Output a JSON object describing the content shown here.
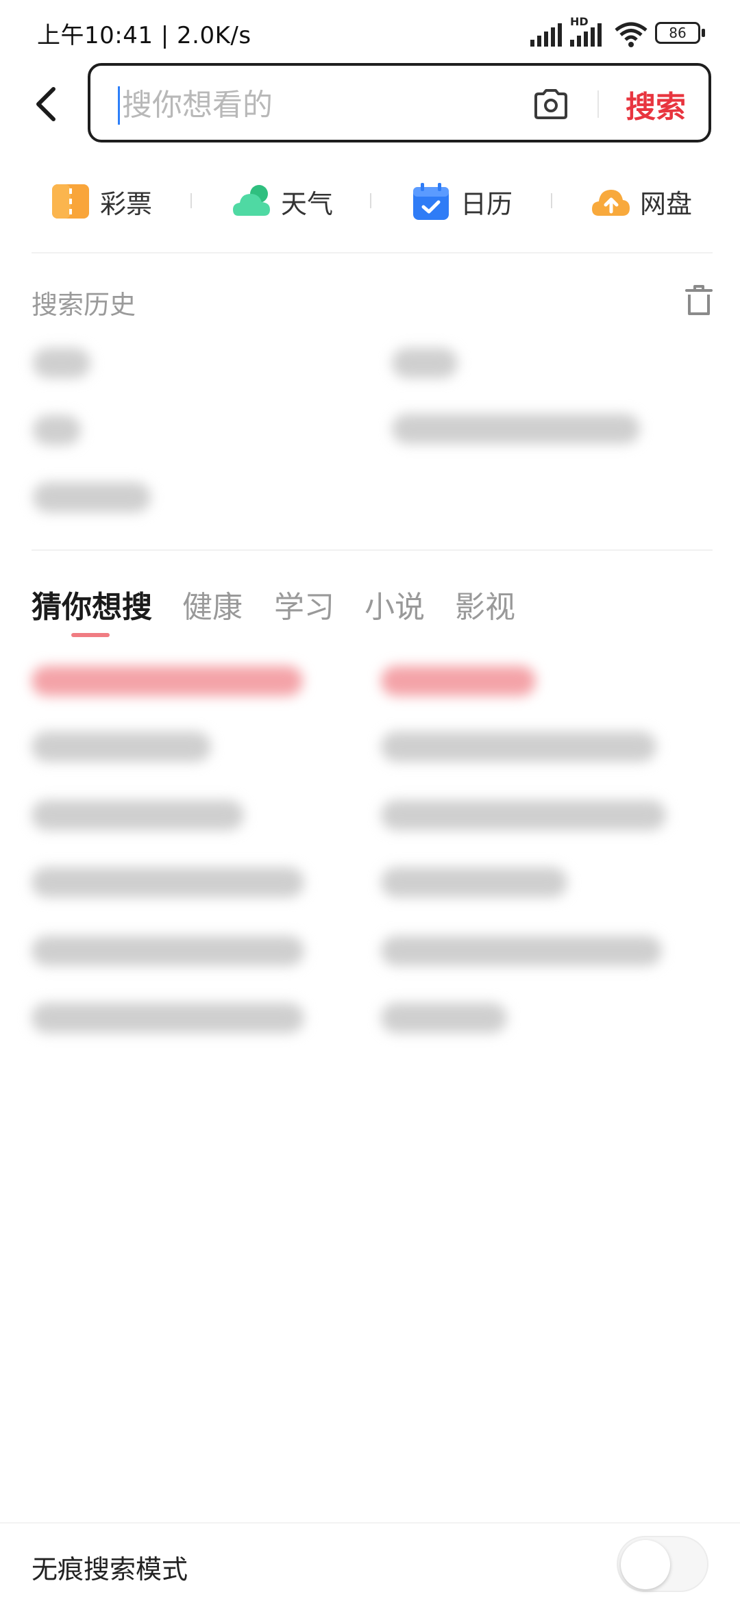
{
  "status_bar": {
    "time_text": "上午10:41 | 2.0K/s",
    "network_label": "HD",
    "battery_level": "86"
  },
  "search": {
    "placeholder": "搜你想看的",
    "value": "",
    "submit_label": "搜索"
  },
  "quick_apps": [
    {
      "label": "彩票",
      "icon": "lottery-ticket-icon",
      "color": "#f9a53a"
    },
    {
      "label": "天气",
      "icon": "weather-cloud-icon",
      "color": "#35c98f"
    },
    {
      "label": "日历",
      "icon": "calendar-icon",
      "color": "#2f7cf6"
    },
    {
      "label": "网盘",
      "icon": "cloud-upload-icon",
      "color": "#f8a93c"
    }
  ],
  "history": {
    "title": "搜索历史",
    "clear_icon": "trash-icon"
  },
  "suggestions": {
    "tabs": [
      {
        "label": "猜你想搜",
        "active": true
      },
      {
        "label": "健康",
        "active": false
      },
      {
        "label": "学习",
        "active": false
      },
      {
        "label": "小说",
        "active": false
      },
      {
        "label": "影视",
        "active": false
      }
    ]
  },
  "incognito": {
    "label": "无痕搜索模式",
    "enabled": false
  },
  "colors": {
    "accent_red": "#e8353f",
    "caret_blue": "#2d7ff9"
  }
}
